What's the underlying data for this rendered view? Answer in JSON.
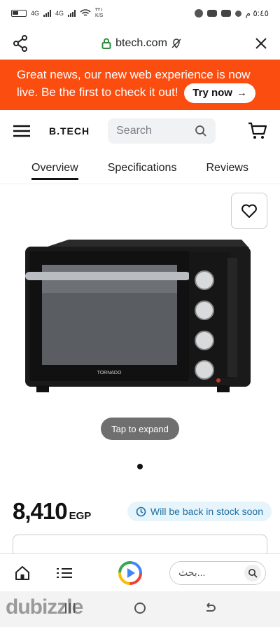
{
  "status_bar": {
    "left_signal_1": "4G",
    "left_signal_2": "4G",
    "speed": "٣٢١\nK/S",
    "time": "٥:٤٥ م"
  },
  "browser": {
    "url": "btech.com"
  },
  "banner": {
    "text": "Great news, our new web experience is now live. Be the first to check it out!",
    "button_label": "Try now",
    "button_arrow": "→"
  },
  "header": {
    "logo": "B.TECH",
    "search_placeholder": "Search"
  },
  "tabs": [
    {
      "label": "Overview",
      "active": true
    },
    {
      "label": "Specifications",
      "active": false
    },
    {
      "label": "Reviews",
      "active": false
    }
  ],
  "gallery": {
    "tap_label": "Tap to expand",
    "brand_on_product": "TORNADO"
  },
  "product": {
    "price": "8,410",
    "currency": "EGP",
    "stock_status": "Will be back in stock soon"
  },
  "bottom_bar": {
    "search_placeholder": "بحث..."
  },
  "watermark": "dubizzle",
  "colors": {
    "banner_bg": "#fa4d0f",
    "stock_bg": "#e6f4fb",
    "stock_text": "#1f6fa3"
  }
}
